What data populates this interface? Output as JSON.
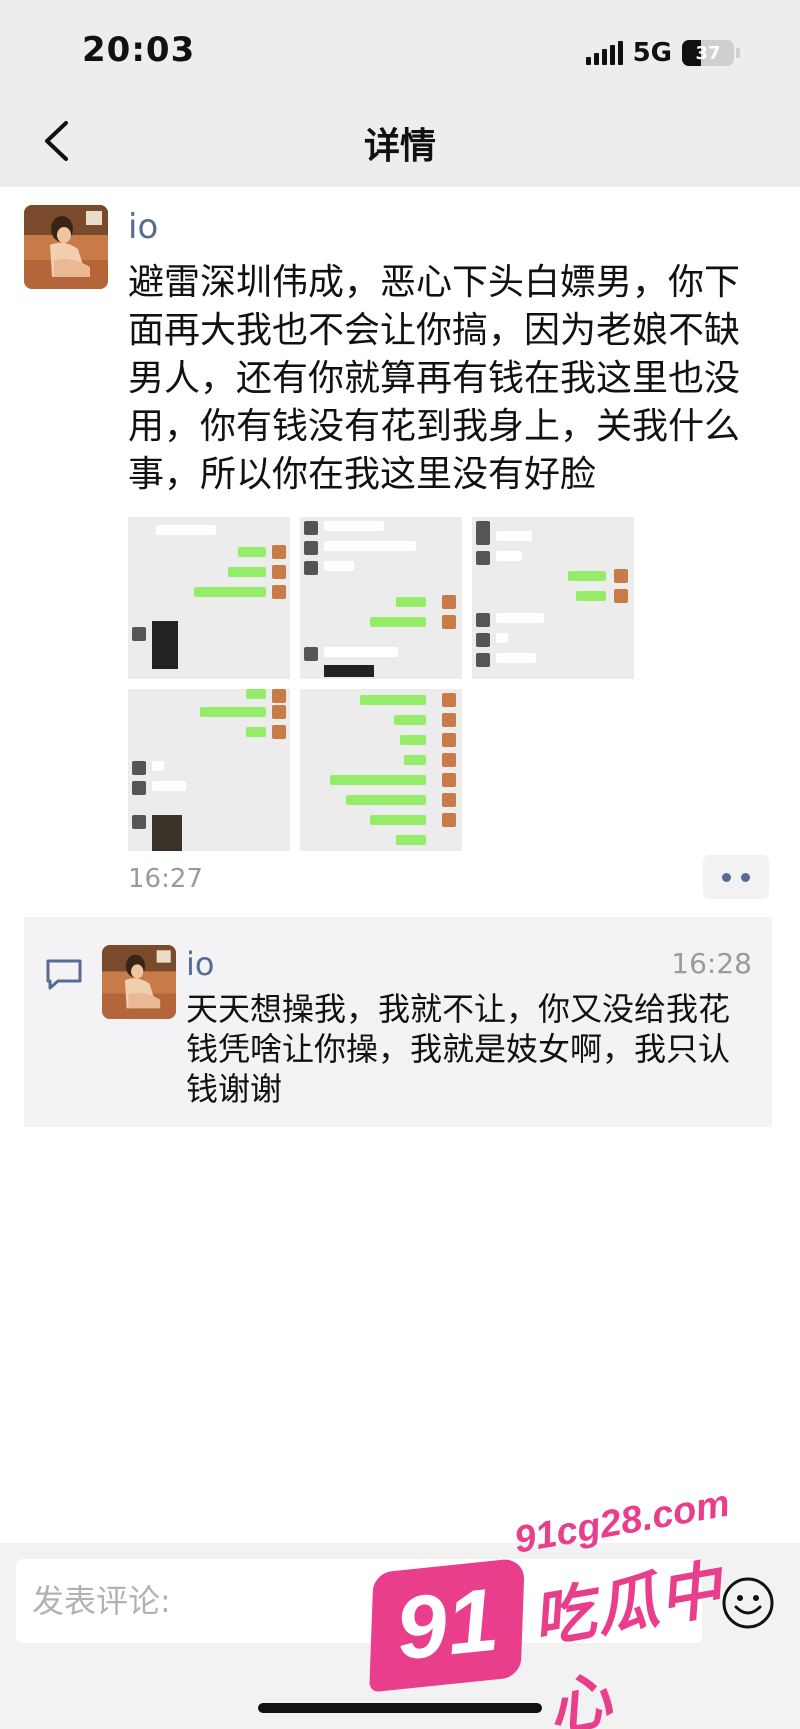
{
  "status_bar": {
    "time": "20:03",
    "network": "5G",
    "battery": "37",
    "battery_level": 0.37
  },
  "nav": {
    "title": "详情",
    "back_icon": "chevron-left-icon"
  },
  "post": {
    "author": "io",
    "text": "避雷深圳伟成，恶心下头白嫖男，你下面再大我也不会让你搞，因为老娘不缺男人，还有你就算再有钱在我这里也没用，你有钱没有花到我身上，关我什么事，所以你在我这里没有好脸",
    "image_count": 5,
    "time": "16:27",
    "more_icon": "more-dots-icon"
  },
  "comment": {
    "icon": "comment-bubble-icon",
    "author": "io",
    "time": "16:28",
    "text": "天天想操我，我就不让，你又没给我花钱凭啥让你操，我就是妓女啊，我只认钱谢谢"
  },
  "input_bar": {
    "placeholder": "发表评论:",
    "emoji_icon": "emoji-smile-icon"
  },
  "watermark": {
    "url": "91cg28.com",
    "number": "91",
    "brand": "吃瓜中心"
  },
  "colors": {
    "link_blue": "#576b95",
    "wechat_green": "#95ec69",
    "watermark_pink": "#e83e8c"
  }
}
